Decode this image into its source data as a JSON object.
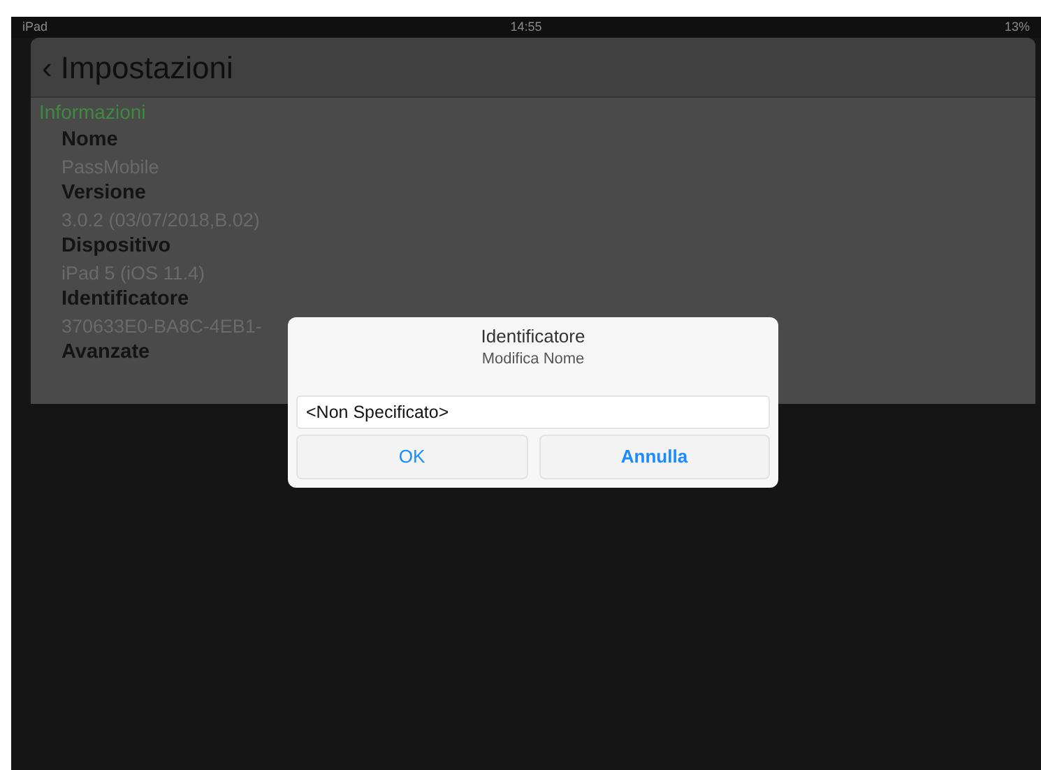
{
  "status_bar": {
    "carrier": "iPad",
    "time": "14:55",
    "battery": "13%"
  },
  "settings": {
    "title": "Impostazioni",
    "back": "‹",
    "section": "Informazioni",
    "fields": [
      {
        "label": "Nome",
        "value": "PassMobile"
      },
      {
        "label": "Versione",
        "value": "3.0.2 (03/07/2018,B.02)"
      },
      {
        "label": "Dispositivo",
        "value": "iPad 5 (iOS 11.4)"
      },
      {
        "label": "Identificatore",
        "value": "370633E0-BA8C-4EB1-"
      },
      {
        "label": "Avanzate"
      }
    ]
  },
  "dialog": {
    "title": "Identificatore",
    "message": "Modifica Nome",
    "input_value": "<Non Specificato>",
    "buttons": [
      {
        "label": "OK",
        "bold": false
      },
      {
        "label": "Annulla",
        "bold": true
      }
    ]
  }
}
